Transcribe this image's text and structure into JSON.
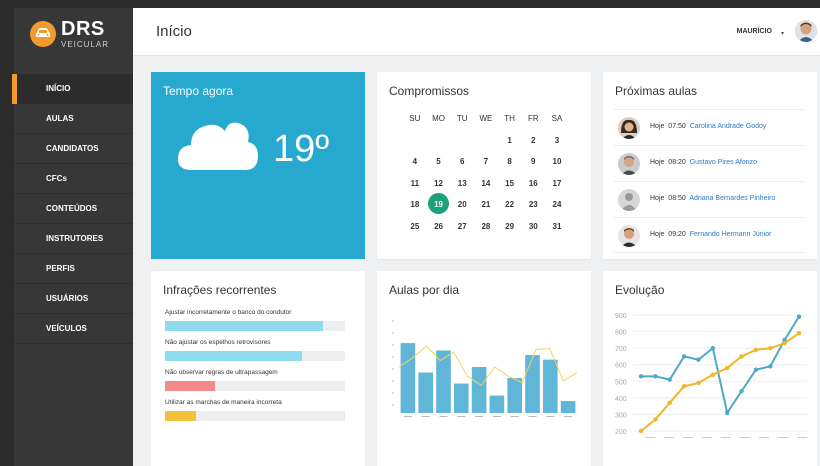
{
  "app": {
    "logo_text": "DRS",
    "logo_sub": "VEICULAR"
  },
  "sidebar": {
    "items": [
      {
        "label": "INÍCIO",
        "active": true
      },
      {
        "label": "AULAS"
      },
      {
        "label": "CANDIDATOS"
      },
      {
        "label": "CFCs"
      },
      {
        "label": "CONTEÚDOS"
      },
      {
        "label": "INSTRUTORES"
      },
      {
        "label": "PERFIS"
      },
      {
        "label": "USUÁRIOS"
      },
      {
        "label": "VEÍCULOS"
      }
    ]
  },
  "header": {
    "title": "Início",
    "user_name": "MAURÍCIO",
    "caret": "▾"
  },
  "weather": {
    "title": "Tempo agora",
    "temperature": "19º",
    "icon": "cloud-icon"
  },
  "calendar": {
    "title": "Compromissos",
    "weekdays": [
      "SU",
      "MO",
      "TU",
      "WE",
      "TH",
      "FR",
      "SA"
    ],
    "weeks": [
      [
        "",
        "",
        "",
        "",
        "1",
        "2",
        "3"
      ],
      [
        "4",
        "5",
        "6",
        "7",
        "8",
        "9",
        "10"
      ],
      [
        "11",
        "12",
        "13",
        "14",
        "15",
        "16",
        "17"
      ],
      [
        "18",
        "19",
        "20",
        "21",
        "22",
        "23",
        "24"
      ],
      [
        "25",
        "26",
        "27",
        "28",
        "29",
        "30",
        "31"
      ]
    ],
    "today": "19",
    "today_color": "#1aa37a"
  },
  "lessons": {
    "title": "Próximas aulas",
    "items": [
      {
        "day": "Hoje",
        "time": "07:50",
        "name": "Carolina Andrade Godoy"
      },
      {
        "day": "Hoje",
        "time": "08:20",
        "name": "Gustavo Pires Afonzo"
      },
      {
        "day": "Hoje",
        "time": "08:50",
        "name": "Adriana Bernardes Pinheiro"
      },
      {
        "day": "Hoje",
        "time": "09:20",
        "name": "Fernando Hermann Júnior"
      }
    ]
  },
  "infractions": {
    "title": "Infrações recorrentes",
    "items": [
      {
        "label": "Ajustar incorretamente o banco do condutor",
        "value": 0.88,
        "color": "#8fdcf0"
      },
      {
        "label": "Não ajustar os espelhos retrovisores",
        "value": 0.76,
        "color": "#8fdcf0"
      },
      {
        "label": "Não observar regras de ultrapassagem",
        "value": 0.28,
        "color": "#f28a8a"
      },
      {
        "label": "Utilizar as marchas de maneira incorreta",
        "value": 0.17,
        "color": "#f3c23c"
      }
    ]
  },
  "chart_data": [
    {
      "type": "bar",
      "title": "Aulas por dia",
      "categories": [
        "",
        "",
        "",
        "",
        "",
        "",
        "",
        "",
        "",
        ""
      ],
      "values": [
        76,
        44,
        68,
        32,
        50,
        19,
        38,
        63,
        58,
        13
      ],
      "line": [
        50,
        60,
        73,
        57,
        66,
        40,
        30,
        50,
        40,
        33,
        69,
        70,
        35,
        44
      ],
      "ylim": [
        0,
        100
      ],
      "bar_color": "#5fb6d8",
      "line_color": "#f3d35a"
    },
    {
      "type": "line",
      "title": "Evolução",
      "yticks": [
        "900",
        "800",
        "700",
        "600",
        "500",
        "400",
        "300",
        "200"
      ],
      "ylim": [
        200,
        900
      ],
      "series": [
        {
          "values": [
            530,
            530,
            510,
            650,
            630,
            700,
            310,
            440,
            570,
            590,
            750,
            890
          ],
          "color": "#4fa8c6"
        },
        {
          "values": [
            200,
            270,
            370,
            470,
            490,
            540,
            580,
            650,
            690,
            700,
            730,
            790
          ],
          "color": "#f1b52a"
        }
      ]
    }
  ]
}
